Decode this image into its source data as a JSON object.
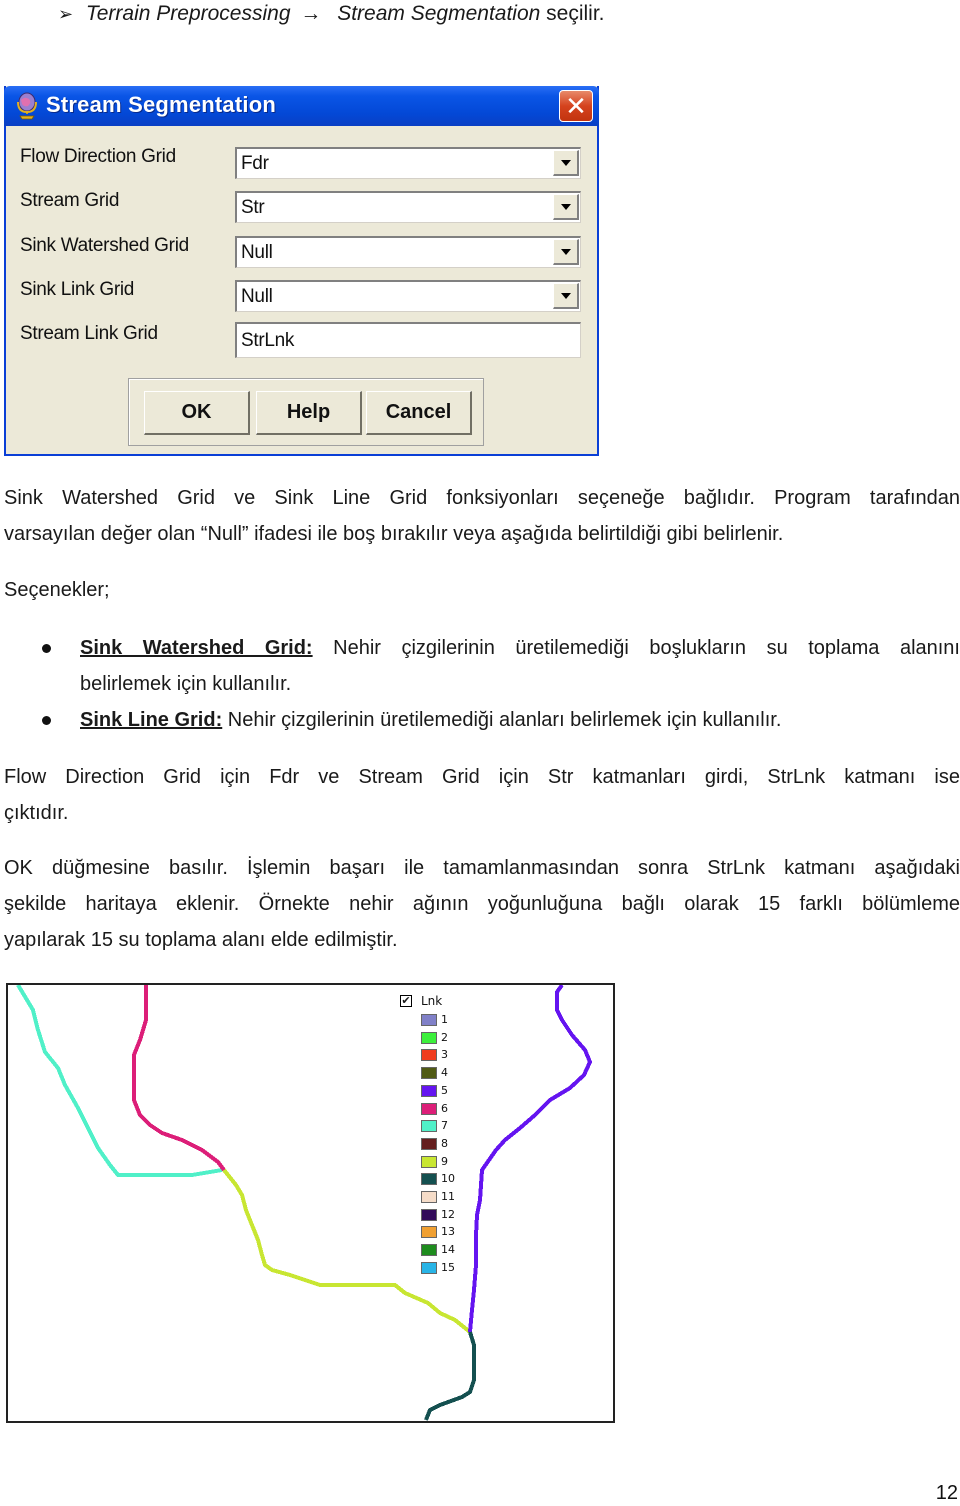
{
  "step": {
    "arrowhead_icon": "➢",
    "menu": "Terrain Preprocessing",
    "arrow_icon": "→",
    "item": "Stream Segmentation",
    "suffix": "seçilir."
  },
  "dialog": {
    "title": "Stream Segmentation",
    "close_icon": "✕",
    "fields": [
      {
        "label": "Flow Direction Grid",
        "value": "Fdr",
        "type": "combo"
      },
      {
        "label": "Stream Grid",
        "value": "Str",
        "type": "combo"
      },
      {
        "label": "Sink Watershed Grid",
        "value": "Null",
        "type": "combo"
      },
      {
        "label": "Sink Link Grid",
        "value": "Null",
        "type": "combo"
      },
      {
        "label": "Stream Link Grid",
        "value": "StrLnk",
        "type": "text"
      }
    ],
    "buttons": {
      "ok": "OK",
      "help": "Help",
      "cancel": "Cancel"
    }
  },
  "text": {
    "p1_line1": "Sink Watershed Grid ve Sink Line Grid fonksiyonları seçeneğe bağlıdır. Program tarafından",
    "p1_line2": "varsayılan değer olan “Null” ifadesi ile boş bırakılır veya aşağıda belirtildiği gibi belirlenir.",
    "options_heading": "Seçenekler;",
    "bullets": [
      {
        "term": "Sink Watershed Grid:",
        "line1": " Nehir çizgilerinin üretilemediği boşlukların su toplama alanını",
        "line2": "belirlemek için kullanılır."
      },
      {
        "term": "Sink Line Grid:",
        "line1": " Nehir çizgilerinin üretilemediği alanları belirlemek için kullanılır.",
        "line2": ""
      }
    ],
    "p2_line1": "Flow Direction Grid için Fdr ve Stream Grid için Str katmanları girdi, StrLnk katmanı ise",
    "p2_line2": "çıktıdır.",
    "p3_line1": "OK düğmesine basılır. İşlemin başarı ile tamamlanmasından sonra StrLnk katmanı aşağıdaki",
    "p3_line2": "şekilde haritaya eklenir. Örnekte nehir ağının yoğunluğuna bağlı olarak 15 farklı bölümleme",
    "p3_line3": "yapılarak 15 su toplama alanı elde edilmiştir."
  },
  "map": {
    "layer_name": "Lnk",
    "layer_checked": true,
    "checkbox_icon": "✔",
    "legend": [
      {
        "label": "1",
        "color": "#8080c8"
      },
      {
        "label": "2",
        "color": "#3cf03c"
      },
      {
        "label": "3",
        "color": "#f03c1e"
      },
      {
        "label": "4",
        "color": "#505a14"
      },
      {
        "label": "5",
        "color": "#6414f0"
      },
      {
        "label": "6",
        "color": "#dc1e78"
      },
      {
        "label": "7",
        "color": "#50f0c8"
      },
      {
        "label": "8",
        "color": "#641e1e"
      },
      {
        "label": "9",
        "color": "#c8e632"
      },
      {
        "label": "10",
        "color": "#145050"
      },
      {
        "label": "11",
        "color": "#f5dcc8"
      },
      {
        "label": "12",
        "color": "#320a5a"
      },
      {
        "label": "13",
        "color": "#f0a032"
      },
      {
        "label": "14",
        "color": "#1e8c1e"
      },
      {
        "label": "15",
        "color": "#28b4e6"
      }
    ],
    "visible_streams": [
      {
        "link": "7",
        "color": "#50f0c8"
      },
      {
        "link": "6",
        "color": "#dc1e78"
      },
      {
        "link": "9",
        "color": "#c8e632"
      },
      {
        "link": "5",
        "color": "#6414f0"
      },
      {
        "link": "10",
        "color": "#145050"
      }
    ]
  },
  "page_number": "12"
}
